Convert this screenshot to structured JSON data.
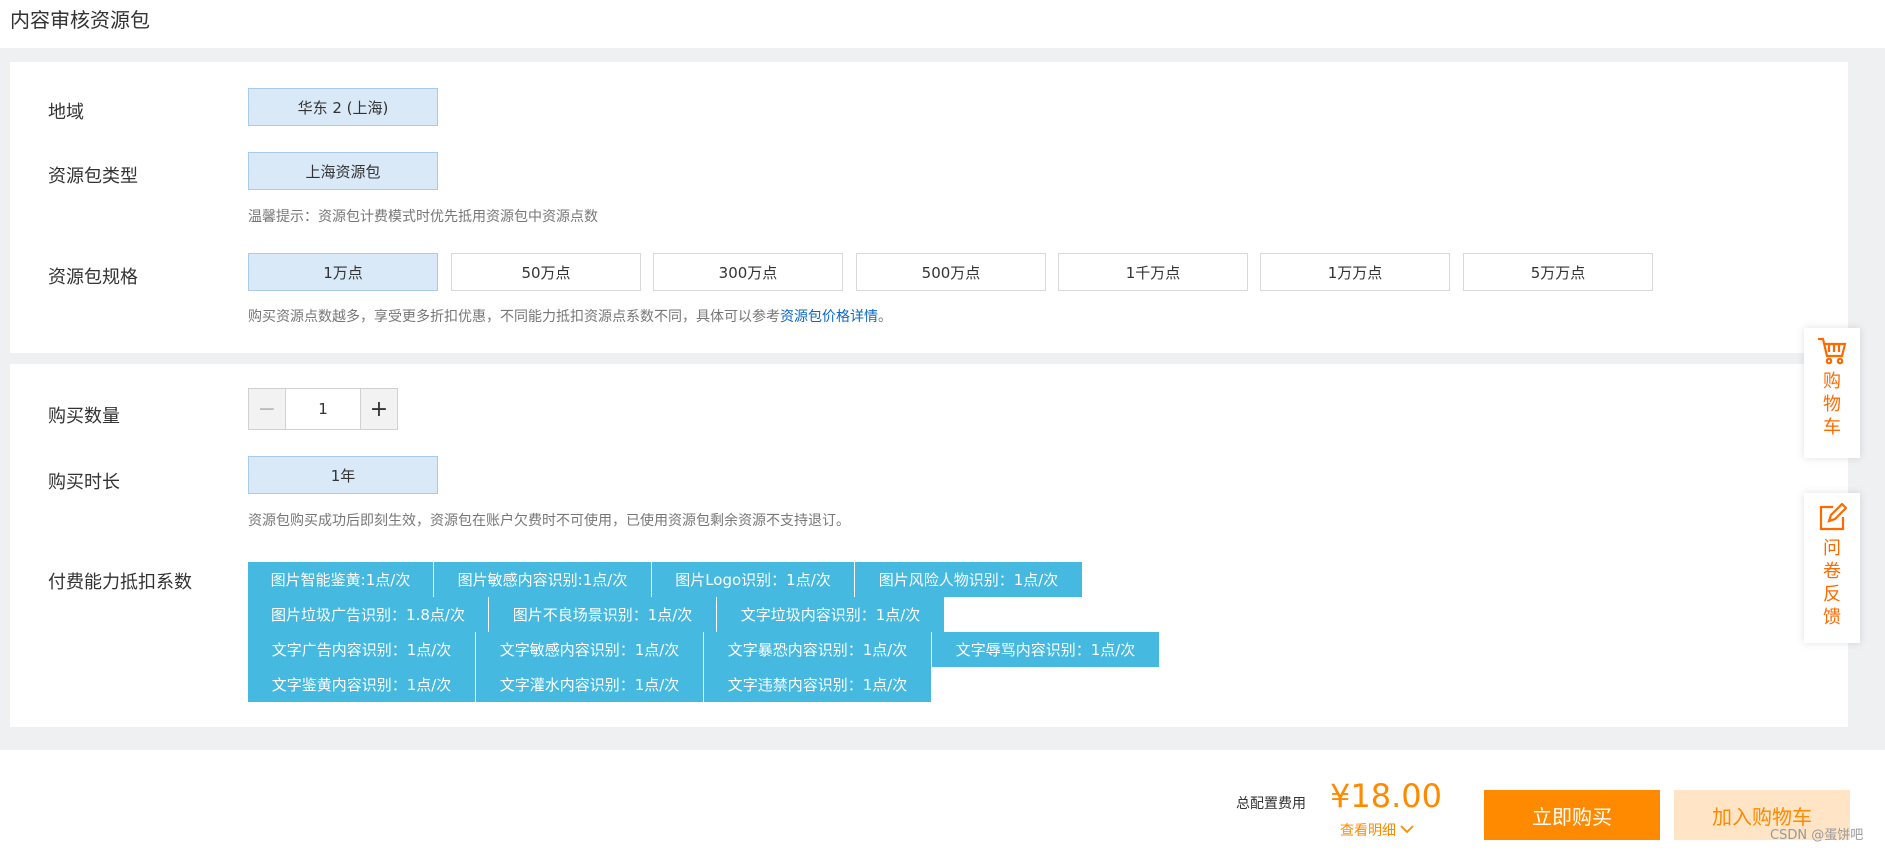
{
  "page": {
    "title": "内容审核资源包"
  },
  "region": {
    "label": "地域",
    "options": [
      "华东 2 (上海)"
    ],
    "selected": 0
  },
  "package_type": {
    "label": "资源包类型",
    "options": [
      "上海资源包"
    ],
    "selected": 0,
    "hint": "温馨提示：资源包计费模式时优先抵用资源包中资源点数"
  },
  "package_spec": {
    "label": "资源包规格",
    "options": [
      "1万点",
      "50万点",
      "300万点",
      "500万点",
      "1千万点",
      "1万万点",
      "5万万点"
    ],
    "selected": 0,
    "hint_prefix": "购买资源点数越多，享受更多折扣优惠，不同能力抵扣资源点系数不同，具体可以参考",
    "hint_link": "资源包价格详情",
    "hint_suffix": "。"
  },
  "quantity": {
    "label": "购买数量",
    "value": "1",
    "minus": "−",
    "plus": "+"
  },
  "duration": {
    "label": "购买时长",
    "options": [
      "1年"
    ],
    "selected": 0,
    "hint": "资源包购买成功后即刻生效，资源包在账户欠费时不可使用，已使用资源包剩余资源不支持退订。"
  },
  "coefficients": {
    "label": "付费能力抵扣系数",
    "rows": [
      [
        "图片智能鉴黄:1点/次",
        "图片敏感内容识别:1点/次",
        "图片Logo识别：1点/次",
        "图片风险人物识别：1点/次"
      ],
      [
        "图片垃圾广告识别：1.8点/次",
        "图片不良场景识别：1点/次",
        "文字垃圾内容识别：1点/次"
      ],
      [
        "文字广告内容识别：1点/次",
        "文字敏感内容识别：1点/次",
        "文字暴恐内容识别：1点/次",
        "文字辱骂内容识别：1点/次"
      ],
      [
        "文字鉴黄内容识别：1点/次",
        "文字灌水内容识别：1点/次",
        "文字违禁内容识别：1点/次"
      ]
    ]
  },
  "side": {
    "cart_text": "购物车",
    "feedback_text": "问卷反馈",
    "cart_icon": "cart-icon",
    "feedback_icon": "edit-icon"
  },
  "footer": {
    "total_label": "总配置费用",
    "price": "¥18.00",
    "detail_link": "查看明细",
    "buy_now": "立即购买",
    "add_cart": "加入购物车"
  },
  "watermark": "CSDN @蛋饼吧",
  "colors": {
    "accent": "#ff8a00",
    "selected_bg": "#d9e9f7",
    "tag_bg": "#45b9e0",
    "link": "#0a68c9"
  }
}
